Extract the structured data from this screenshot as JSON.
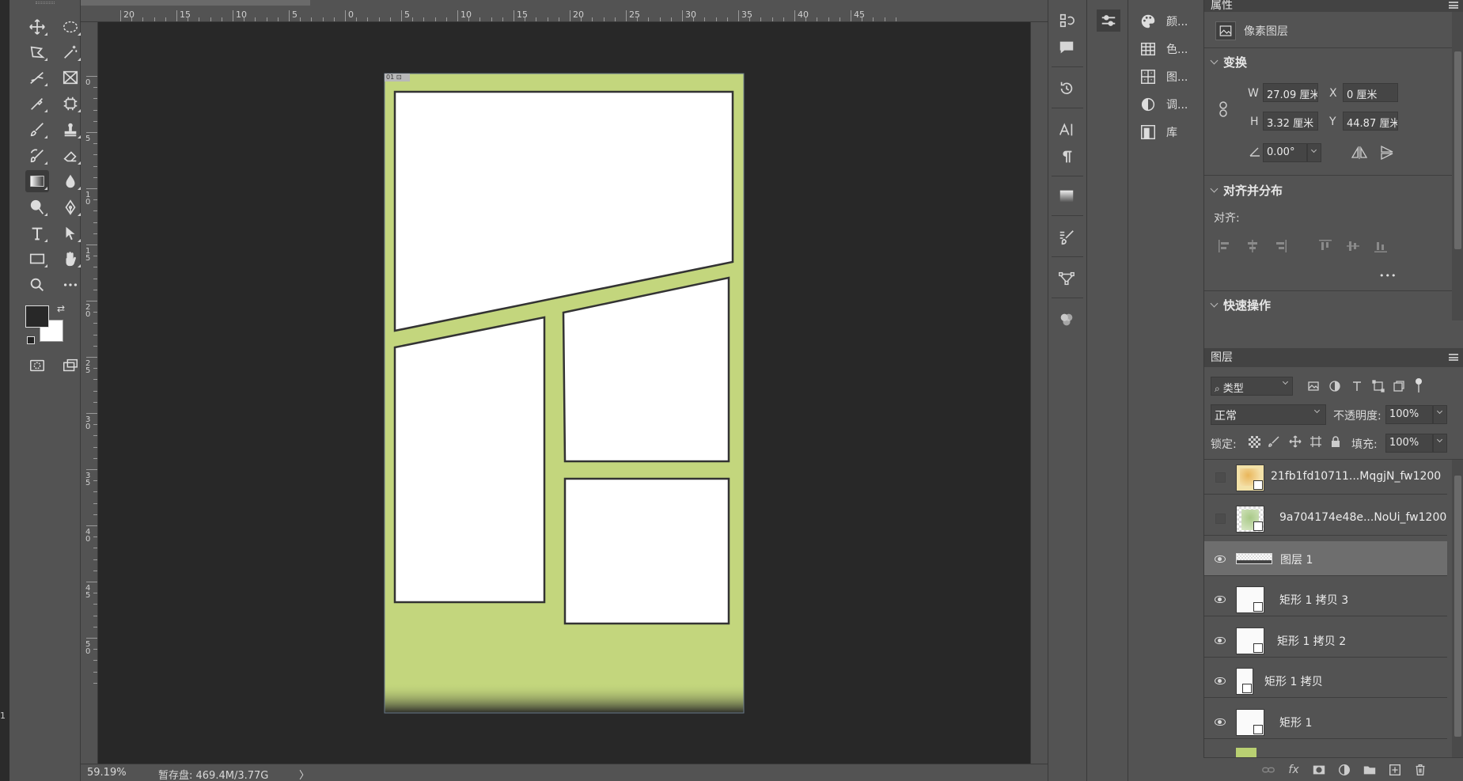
{
  "status": {
    "zoom": "59.19%",
    "scratch": "暂存盘: 469.4M/3.77G",
    "arrow": "〉"
  },
  "ruler": {
    "top_labels": [
      "20",
      "15",
      "10",
      "5",
      "0",
      "5",
      "10",
      "15",
      "20",
      "25",
      "30",
      "35",
      "40",
      "45"
    ],
    "left_labels": [
      "0",
      "5",
      "1\n0",
      "1\n5",
      "2\n0",
      "2\n5",
      "3\n0",
      "3\n5",
      "4\n0",
      "4\n5",
      "5\n0"
    ]
  },
  "artboard": {
    "label": "01 ⊡",
    "bg_color": "#c3d67d",
    "panel_color": "#ffffff",
    "border_color": "#333333"
  },
  "dock_panels": [
    {
      "icon": "color-icon",
      "label": "颜..."
    },
    {
      "icon": "swatches-icon",
      "label": "色..."
    },
    {
      "icon": "patterns-icon",
      "label": "图..."
    },
    {
      "icon": "adjustments-icon",
      "label": "调..."
    },
    {
      "icon": "libraries-icon",
      "label": "库"
    }
  ],
  "properties": {
    "panel_title": "属性",
    "layer_type": "像素图层",
    "transform": {
      "title": "变换",
      "w_label": "W",
      "w_value": "27.09 厘米",
      "x_label": "X",
      "x_value": "0 厘米",
      "h_label": "H",
      "h_value": "3.32 厘米",
      "y_label": "Y",
      "y_value": "44.87 厘米",
      "angle_value": "0.00°"
    },
    "align": {
      "title": "对齐并分布",
      "sub_label": "对齐:",
      "more": "•••"
    },
    "quick_actions": {
      "title": "快速操作"
    }
  },
  "layers": {
    "panel_title": "图层",
    "filter_label": "类型",
    "blend_mode": "正常",
    "opacity_label": "不透明度:",
    "opacity_value": "100%",
    "lock_label": "锁定:",
    "fill_label": "填充:",
    "fill_value": "100%",
    "items": [
      {
        "name": "21fb1fd10711...MqgjN_fw1200",
        "visible": false,
        "selected": false
      },
      {
        "name": "9a704174e48e...NoUi_fw1200",
        "visible": false,
        "selected": false
      },
      {
        "name": "图层 1",
        "visible": true,
        "selected": true
      },
      {
        "name": "矩形 1 拷贝 3",
        "visible": true,
        "selected": false
      },
      {
        "name": "矩形 1 拷贝 2",
        "visible": true,
        "selected": false
      },
      {
        "name": "矩形 1 拷贝",
        "visible": true,
        "selected": false
      },
      {
        "name": "矩形 1",
        "visible": true,
        "selected": false
      }
    ],
    "bottom_fx": "fx"
  },
  "left_edge_text": "1"
}
